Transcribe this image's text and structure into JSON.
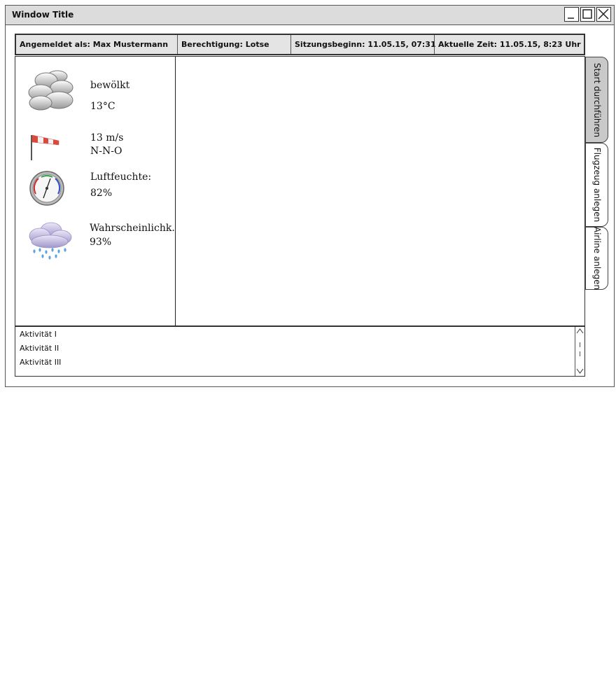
{
  "window": {
    "title": "Window Title"
  },
  "info_bar": {
    "user": "Angemeldet als: Max Mustermann",
    "permission": "Berechtigung: Lotse",
    "session_start": "Sitzungsbeginn: 11.05.15, 07:31",
    "current_time": "Aktuelle Zeit: 11.05.15, 8:23 Uhr"
  },
  "weather": {
    "condition": "bewölkt",
    "temperature": "13°C",
    "wind_speed": "13 m/s",
    "wind_direction": "N-N-O",
    "humidity_label": "Luftfeuchte:",
    "humidity_value": "82%",
    "precip_label": "Wahrscheinlichk.",
    "precip_value": "93%"
  },
  "tabs": [
    {
      "label": "Start durchführen",
      "active": true
    },
    {
      "label": "Flugzeug anlegen",
      "active": false
    },
    {
      "label": "Airline anlegen",
      "active": false
    }
  ],
  "activities": [
    "Aktivität I",
    "Aktivität II",
    "Aktivität III"
  ],
  "icons": {
    "cloudy": "cloudy-icon",
    "windsock": "windsock-icon",
    "hygrometer": "hygrometer-icon",
    "rain": "rain-cloud-icon"
  }
}
